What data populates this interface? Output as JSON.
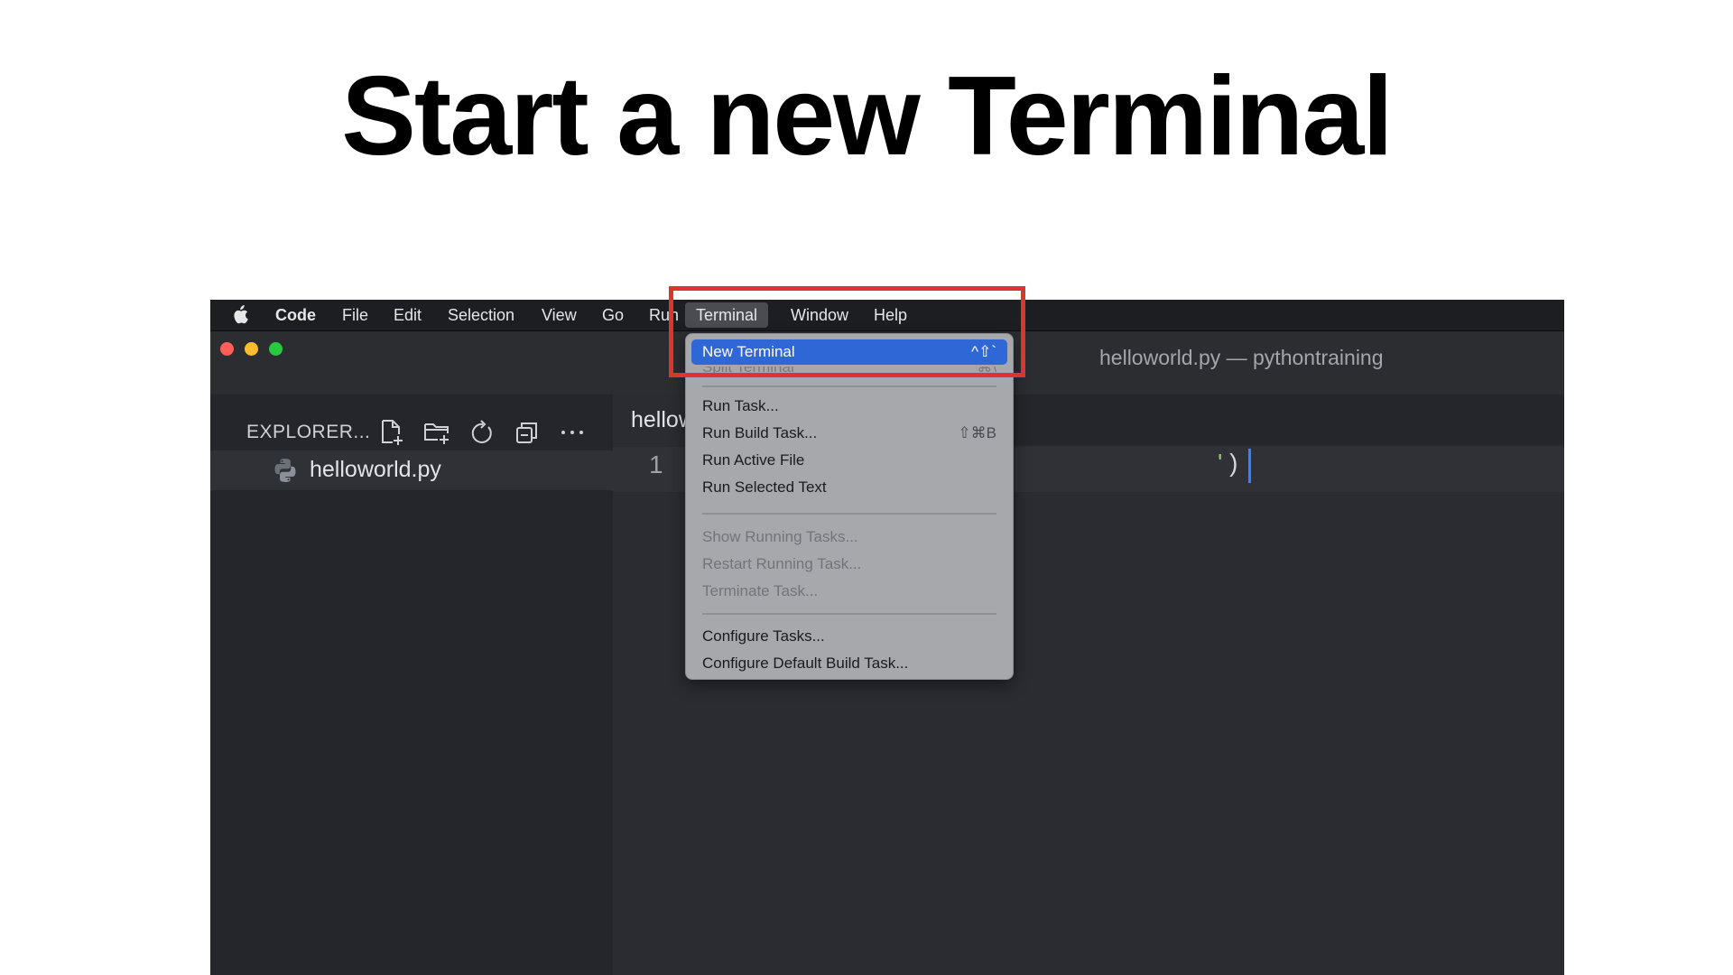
{
  "slide": {
    "title": "Start a new Terminal"
  },
  "menubar": {
    "app_name": "Code",
    "items": [
      "File",
      "Edit",
      "Selection",
      "View",
      "Go",
      "Run",
      "Terminal",
      "Window",
      "Help"
    ],
    "active": "Terminal"
  },
  "window": {
    "title": "helloworld.py — pythontraining",
    "traffic_lights": {
      "close": "#ff5f57",
      "minimize": "#febc2e",
      "zoom": "#28c840"
    }
  },
  "sidebar": {
    "label": "EXPLORER...",
    "icons": [
      "new-file-icon",
      "new-folder-icon",
      "refresh-icon",
      "collapse-all-icon",
      "more-icon"
    ],
    "files": [
      {
        "name": "helloworld.py",
        "icon": "python-file-icon"
      }
    ]
  },
  "editor": {
    "tab_label": "hellow",
    "line_number": "1",
    "code_tail_quote": "'",
    "code_tail_paren": ")"
  },
  "terminal_menu": {
    "new_terminal": {
      "label": "New Terminal",
      "shortcut": "^⇧`"
    },
    "split_terminal": {
      "label": "Split Terminal",
      "shortcut": "⌘\\"
    },
    "run_task": "Run Task...",
    "run_build_task": {
      "label": "Run Build Task...",
      "shortcut": "⇧⌘B"
    },
    "run_active_file": "Run Active File",
    "run_selected_text": "Run Selected Text",
    "show_running_tasks": "Show Running Tasks...",
    "restart_running_task": "Restart Running Task...",
    "terminate_task": "Terminate Task...",
    "configure_tasks": "Configure Tasks...",
    "configure_default_build_task": "Configure Default Build Task..."
  },
  "colors": {
    "highlight_box": "#d9372b",
    "menu_selection": "#2f68d6",
    "cursor": "#3b82f6"
  }
}
